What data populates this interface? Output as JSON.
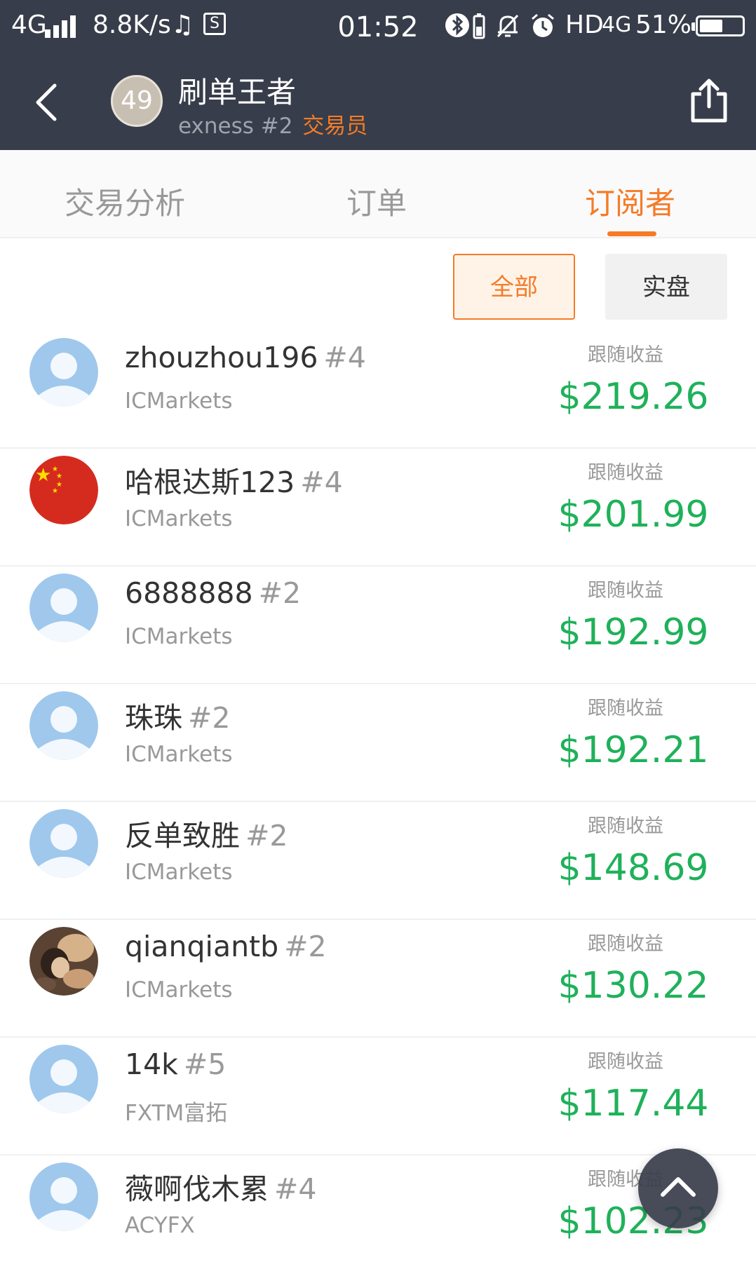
{
  "status_bar": {
    "network": "4G",
    "speed": "8.8K/s",
    "time": "01:52",
    "hd": "HD",
    "network2": "4G",
    "battery": "51%"
  },
  "header": {
    "badge_number": "49",
    "title": "刷单王者",
    "subtitle": "exness #2",
    "role": "交易员"
  },
  "tabs": [
    {
      "label": "交易分析",
      "active": false
    },
    {
      "label": "订单",
      "active": false
    },
    {
      "label": "订阅者",
      "active": true
    }
  ],
  "filters": {
    "all": "全部",
    "real": "实盘",
    "selected": "全部"
  },
  "colors": {
    "accent": "#f57b27",
    "profit": "#1fb15a",
    "header_bg": "#373d4a"
  },
  "subscribers": [
    {
      "name": "zhouzhou196",
      "rank": "#4",
      "broker": "ICMarkets",
      "profit_label": "跟随收益",
      "profit": "$219.26",
      "avatar": "default-user"
    },
    {
      "name": "哈根达斯123",
      "rank": "#4",
      "broker": "ICMarkets",
      "profit_label": "跟随收益",
      "profit": "$201.99",
      "avatar": "china-flag"
    },
    {
      "name": "6888888",
      "rank": "#2",
      "broker": "ICMarkets",
      "profit_label": "跟随收益",
      "profit": "$192.99",
      "avatar": "default-user"
    },
    {
      "name": "珠珠",
      "rank": "#2",
      "broker": "ICMarkets",
      "profit_label": "跟随收益",
      "profit": "$192.21",
      "avatar": "default-user"
    },
    {
      "name": "反单致胜",
      "rank": "#2",
      "broker": "ICMarkets",
      "profit_label": "跟随收益",
      "profit": "$148.69",
      "avatar": "default-user"
    },
    {
      "name": "qianqiantb",
      "rank": "#2",
      "broker": "ICMarkets",
      "profit_label": "跟随收益",
      "profit": "$130.22",
      "avatar": "photo"
    },
    {
      "name": "14k",
      "rank": "#5",
      "broker": "FXTM富拓",
      "profit_label": "跟随收益",
      "profit": "$117.44",
      "avatar": "default-user"
    },
    {
      "name": "薇啊伐木累",
      "rank": "#4",
      "broker": "ACYFX",
      "profit_label": "跟随收益",
      "profit": "$102.23",
      "avatar": "default-user"
    }
  ]
}
